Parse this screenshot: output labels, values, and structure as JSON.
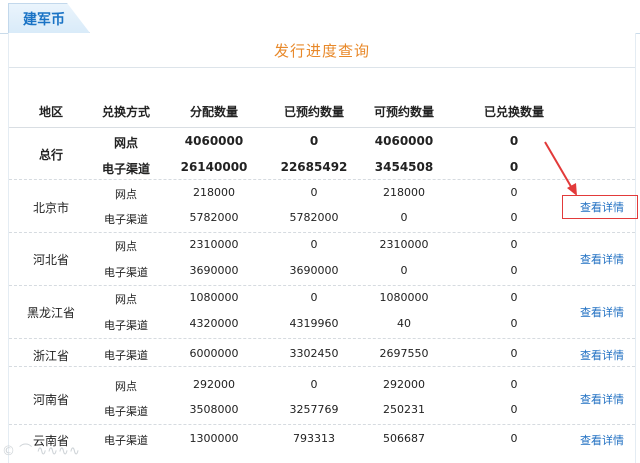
{
  "tab": {
    "label": "建军币"
  },
  "page": {
    "title": "发行进度查询"
  },
  "columns": [
    "地区",
    "兑换方式",
    "分配数量",
    "已预约数量",
    "可预约数量",
    "已兑换数量"
  ],
  "total": {
    "region": "总行",
    "rows": [
      {
        "method": "网点",
        "allocated": "4060000",
        "reserved": "0",
        "available": "4060000",
        "exchanged": "0"
      },
      {
        "method": "电子渠道",
        "allocated": "26140000",
        "reserved": "22685492",
        "available": "3454508",
        "exchanged": "0"
      }
    ]
  },
  "regions": [
    {
      "name": "北京市",
      "link": "查看详情",
      "rows": [
        {
          "method": "网点",
          "allocated": "218000",
          "reserved": "0",
          "available": "218000",
          "exchanged": "0"
        },
        {
          "method": "电子渠道",
          "allocated": "5782000",
          "reserved": "5782000",
          "available": "0",
          "exchanged": "0"
        }
      ]
    },
    {
      "name": "河北省",
      "link": "查看详情",
      "rows": [
        {
          "method": "网点",
          "allocated": "2310000",
          "reserved": "0",
          "available": "2310000",
          "exchanged": "0"
        },
        {
          "method": "电子渠道",
          "allocated": "3690000",
          "reserved": "3690000",
          "available": "0",
          "exchanged": "0"
        }
      ]
    },
    {
      "name": "黑龙江省",
      "link": "查看详情",
      "rows": [
        {
          "method": "网点",
          "allocated": "1080000",
          "reserved": "0",
          "available": "1080000",
          "exchanged": "0"
        },
        {
          "method": "电子渠道",
          "allocated": "4320000",
          "reserved": "4319960",
          "available": "40",
          "exchanged": "0"
        }
      ]
    },
    {
      "name": "浙江省",
      "link": "查看详情",
      "rows": [
        {
          "method": "电子渠道",
          "allocated": "6000000",
          "reserved": "3302450",
          "available": "2697550",
          "exchanged": "0"
        }
      ]
    },
    {
      "name": "河南省",
      "link": "查看详情",
      "rows": [
        {
          "method": "网点",
          "allocated": "292000",
          "reserved": "0",
          "available": "292000",
          "exchanged": "0"
        },
        {
          "method": "电子渠道",
          "allocated": "3508000",
          "reserved": "3257769",
          "available": "250231",
          "exchanged": "0"
        }
      ]
    },
    {
      "name": "云南省",
      "link": "查看详情",
      "rows": [
        {
          "method": "电子渠道",
          "allocated": "1300000",
          "reserved": "793313",
          "available": "506687",
          "exchanged": "0"
        }
      ]
    }
  ],
  "colors": {
    "accent": "#e8892a",
    "link": "#1f6fc2",
    "highlight": "#e23a3a"
  }
}
